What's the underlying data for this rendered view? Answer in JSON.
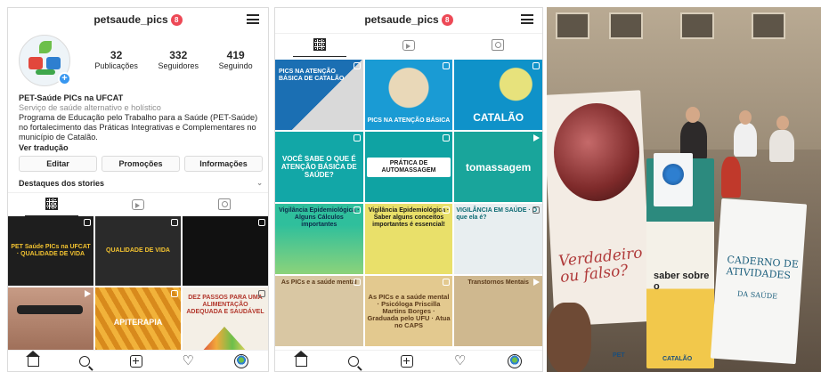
{
  "profile": {
    "username": "petsaude_pics",
    "notification_count": "8",
    "stats": [
      {
        "value": "32",
        "label": "Publicações"
      },
      {
        "value": "332",
        "label": "Seguidores"
      },
      {
        "value": "419",
        "label": "Seguindo"
      }
    ],
    "bio": {
      "name": "PET-Saúde PICs na UFCAT",
      "category": "Serviço de saúde alternativo e holístico",
      "text": "Programa de Educação pelo Trabalho para a Saúde (PET-Saúde) no fortalecimento das Práticas Integrativas e Complementares no município de Catalão.",
      "translate": "Ver tradução"
    },
    "buttons": {
      "edit": "Editar",
      "promotions": "Promoções",
      "info": "Informações"
    },
    "highlights_label": "Destaques dos stories",
    "posts": [
      {
        "text": "PET Saúde PICs na UFCAT · QUALIDADE DE VIDA",
        "bg": "#1e1e1e"
      },
      {
        "text": "QUALIDADE DE VIDA",
        "bg": "#2a2a2a"
      },
      {
        "text": "",
        "bg": "#111111"
      },
      {
        "text": "",
        "bg": "#c79b85"
      },
      {
        "text": "APITERAPIA",
        "bg": "#d88a1c"
      },
      {
        "text": "DEZ PASSOS PARA UMA ALIMENTAÇÃO ADEQUADA E SAUDÁVEL",
        "bg": "#f4efe6"
      }
    ]
  },
  "feed": {
    "username": "petsaude_pics",
    "notification_count": "8",
    "posts": [
      {
        "text": "PICS NA ATENÇÃO BÁSICA DE CATALÃO",
        "bg": "#1b6fb3",
        "fg": "#ffffff"
      },
      {
        "text": "PICS NA ATENÇÃO BÁSICA",
        "bg": "#1a9bd4",
        "fg": "#ffffff"
      },
      {
        "text": "CATALÃO",
        "bg": "#0f92c9",
        "fg": "#ffffff"
      },
      {
        "text": "VOCÊ SABE O QUE É ATENÇÃO BÁSICA DE SAÚDE?",
        "bg": "#12a7a7",
        "fg": "#ffffff"
      },
      {
        "text": "PRÁTICA DE AUTOMASSAGEM",
        "bg": "#0fa3a3",
        "fg": "#1a1a1a"
      },
      {
        "text": "tomassagem",
        "bg": "#19a59b",
        "fg": "#ffffff"
      },
      {
        "text": "Vigilância Epidemiológica · Alguns Cálculos importantes",
        "bg": "#2fbf9c",
        "fg": "#0c2a4a"
      },
      {
        "text": "Vigilância Epidemiológica · Saber alguns conceitos importantes é essencial!",
        "bg": "#e9e06a",
        "fg": "#1a1a1a"
      },
      {
        "text": "VIGILÂNCIA EM SAÚDE · O que ela é?",
        "bg": "#e8eef0",
        "fg": "#0c6a73"
      },
      {
        "text": "As PICs e a saúde mental",
        "bg": "#d9c7a3",
        "fg": "#5b3a1a"
      },
      {
        "text": "As PICs e a saúde mental · Psicóloga Priscilla Martins Borges · Graduada pelo UFU · Atua no CAPS",
        "bg": "#e3c98f",
        "fg": "#5b3a1a"
      },
      {
        "text": "Transtornos Mentais",
        "bg": "#cfb88f",
        "fg": "#5b3a1a"
      }
    ]
  },
  "photo": {
    "card_left": "Verdadeiro ou falso?",
    "card_mid": "saber sobre o",
    "card_right": "CADERNO DE ATIVIDADES",
    "card_right_sub": "DA SAÚDE",
    "logo": "CATALÃO",
    "logo2": "PET"
  },
  "colors": {
    "badge": "#ed4956",
    "link_blue": "#3897f0",
    "text": "#262626",
    "muted": "#8e8e8e"
  }
}
